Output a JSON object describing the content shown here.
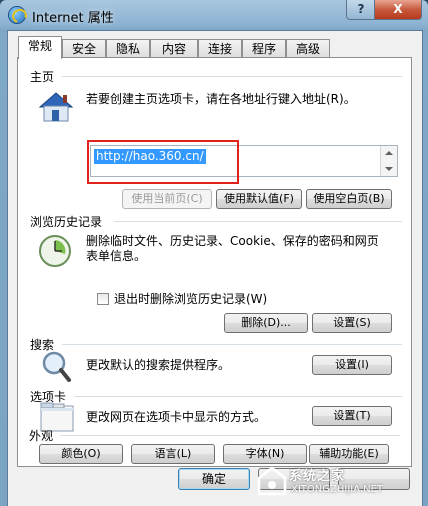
{
  "window": {
    "title": "Internet 属性",
    "help_label": "?",
    "close_label": "X"
  },
  "tabs": [
    "常规",
    "安全",
    "隐私",
    "内容",
    "连接",
    "程序",
    "高级"
  ],
  "home": {
    "heading": "主页",
    "description": "若要创建主页选项卡，请在各地址行键入地址(R)。",
    "url": "http://hao.360.cn/",
    "buttons": [
      "使用当前页(C)",
      "使用默认值(F)",
      "使用空白页(B)"
    ]
  },
  "history": {
    "heading": "浏览历史记录",
    "description": "删除临时文件、历史记录、Cookie、保存的密码和网页表单信息。",
    "checkbox_label": "退出时删除浏览历史记录(W)",
    "delete_button": "删除(D)...",
    "settings_button": "设置(S)"
  },
  "search": {
    "heading": "搜索",
    "description": "更改默认的搜索提供程序。",
    "settings_button": "设置(I)"
  },
  "tabs_section": {
    "heading": "选项卡",
    "description": "更改网页在选项卡中显示的方式。",
    "settings_button": "设置(T)"
  },
  "appearance": {
    "heading": "外观",
    "buttons": [
      "颜色(O)",
      "语言(L)",
      "字体(N)",
      "辅助功能(E)"
    ]
  },
  "footer": {
    "ok_label": "确定"
  },
  "watermark": {
    "brand": "系统之家",
    "sub": "XITONGZHIJIA.NET"
  },
  "colors": {
    "selection": "#3399ff",
    "highlight_box": "#e0241b"
  }
}
